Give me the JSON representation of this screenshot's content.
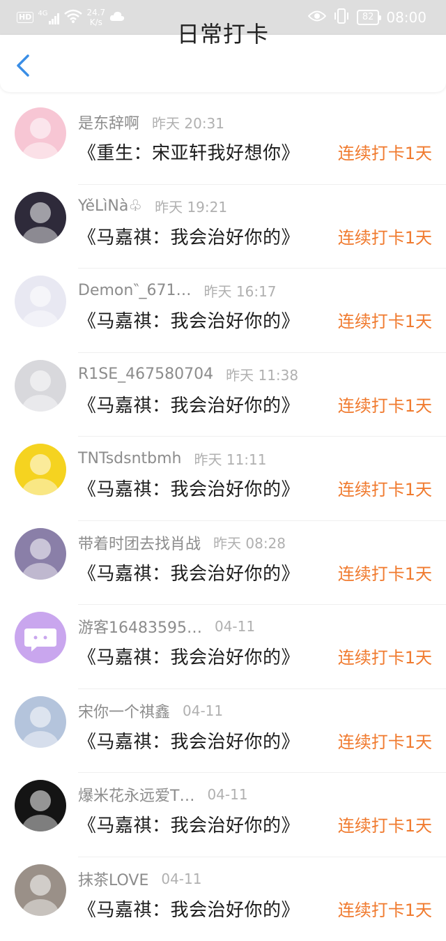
{
  "status_bar": {
    "hd": "HD",
    "network": "4G",
    "speed_value": "24.7",
    "speed_unit": "K/s",
    "battery": "82",
    "time": "08:00",
    "icons": [
      "hd-icon",
      "signal-icon",
      "wifi-icon",
      "cloud-icon",
      "eye-icon",
      "vibrate-icon",
      "battery-icon"
    ]
  },
  "header": {
    "title": "日常打卡",
    "back_icon": "chevron-left-icon"
  },
  "colors": {
    "accent": "#3a8ee6",
    "streak": "#f07a2e",
    "username": "#8c8c8c",
    "time": "#b0b0b0"
  },
  "entries": [
    {
      "username": "是东辞啊",
      "time": "昨天 20:31",
      "title": "《重生：宋亚轩我好想你》",
      "streak": "连续打卡1天",
      "avatar_color": "#f7c6d4",
      "avatar": "anime-girl-pink-avatar"
    },
    {
      "username": "YěLìNà♧",
      "time": "昨天 19:21",
      "title": "《马嘉祺：我会治好你的》",
      "streak": "连续打卡1天",
      "avatar_color": "#2e2a3a",
      "avatar": "anime-girl-dark-avatar"
    },
    {
      "username": "Demon‶_671…",
      "time": "昨天 16:17",
      "title": "《马嘉祺：我会治好你的》",
      "streak": "连续打卡1天",
      "avatar_color": "#e8e8f2",
      "avatar": "anime-girl-white-avatar"
    },
    {
      "username": "R1SE_467580704",
      "time": "昨天 11:38",
      "title": "《马嘉祺：我会治好你的》",
      "streak": "连续打卡1天",
      "avatar_color": "#d8d8dc",
      "avatar": "group-photo-avatar"
    },
    {
      "username": "TNTsdsntbmh",
      "time": "昨天 11:11",
      "title": "《马嘉祺：我会治好你的》",
      "streak": "连续打卡1天",
      "avatar_color": "#f5d320",
      "avatar": "cartoon-yellow-avatar"
    },
    {
      "username": "带着时团去找肖战",
      "time": "昨天 08:28",
      "title": "《马嘉祺：我会治好你的》",
      "streak": "连续打卡1天",
      "avatar_color": "#8a7fa8",
      "avatar": "boy-photo-avatar"
    },
    {
      "username": "游客16483595…",
      "time": "04-11",
      "title": "《马嘉祺：我会治好你的》",
      "streak": "连续打卡1天",
      "avatar_color": "#c9a6ee",
      "avatar": "chat-bubble-avatar"
    },
    {
      "username": "宋你一个祺鑫",
      "time": "04-11",
      "title": "《马嘉祺：我会治好你的》",
      "streak": "连续打卡1天",
      "avatar_color": "#b4c4dc",
      "avatar": "group-photo-blue-avatar"
    },
    {
      "username": "爆米花永远爱T…",
      "time": "04-11",
      "title": "《马嘉祺：我会治好你的》",
      "streak": "连续打卡1天",
      "avatar_color": "#141414",
      "avatar": "moon-dark-avatar"
    },
    {
      "username": "抹茶LOVE",
      "time": "04-11",
      "title": "《马嘉祺：我会治好你的》",
      "streak": "连续打卡1天",
      "avatar_color": "#9a9088",
      "avatar": "anime-sketch-avatar"
    }
  ]
}
